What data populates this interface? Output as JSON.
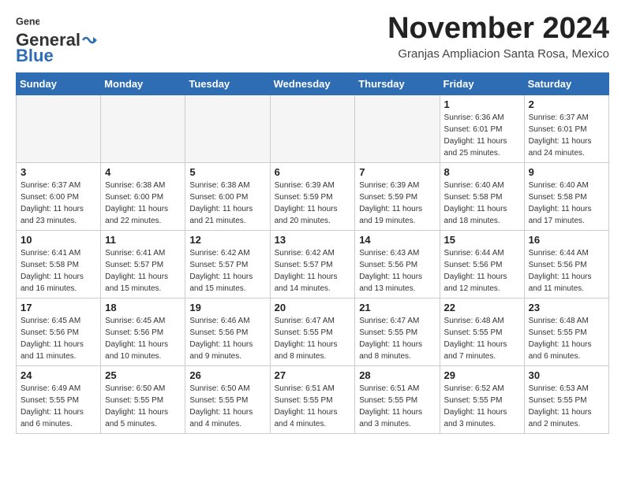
{
  "header": {
    "logo_general": "General",
    "logo_blue": "Blue",
    "month_title": "November 2024",
    "location": "Granjas Ampliacion Santa Rosa, Mexico"
  },
  "days_of_week": [
    "Sunday",
    "Monday",
    "Tuesday",
    "Wednesday",
    "Thursday",
    "Friday",
    "Saturday"
  ],
  "weeks": [
    [
      {
        "day": "",
        "info": ""
      },
      {
        "day": "",
        "info": ""
      },
      {
        "day": "",
        "info": ""
      },
      {
        "day": "",
        "info": ""
      },
      {
        "day": "",
        "info": ""
      },
      {
        "day": "1",
        "info": "Sunrise: 6:36 AM\nSunset: 6:01 PM\nDaylight: 11 hours and 25 minutes."
      },
      {
        "day": "2",
        "info": "Sunrise: 6:37 AM\nSunset: 6:01 PM\nDaylight: 11 hours and 24 minutes."
      }
    ],
    [
      {
        "day": "3",
        "info": "Sunrise: 6:37 AM\nSunset: 6:00 PM\nDaylight: 11 hours and 23 minutes."
      },
      {
        "day": "4",
        "info": "Sunrise: 6:38 AM\nSunset: 6:00 PM\nDaylight: 11 hours and 22 minutes."
      },
      {
        "day": "5",
        "info": "Sunrise: 6:38 AM\nSunset: 6:00 PM\nDaylight: 11 hours and 21 minutes."
      },
      {
        "day": "6",
        "info": "Sunrise: 6:39 AM\nSunset: 5:59 PM\nDaylight: 11 hours and 20 minutes."
      },
      {
        "day": "7",
        "info": "Sunrise: 6:39 AM\nSunset: 5:59 PM\nDaylight: 11 hours and 19 minutes."
      },
      {
        "day": "8",
        "info": "Sunrise: 6:40 AM\nSunset: 5:58 PM\nDaylight: 11 hours and 18 minutes."
      },
      {
        "day": "9",
        "info": "Sunrise: 6:40 AM\nSunset: 5:58 PM\nDaylight: 11 hours and 17 minutes."
      }
    ],
    [
      {
        "day": "10",
        "info": "Sunrise: 6:41 AM\nSunset: 5:58 PM\nDaylight: 11 hours and 16 minutes."
      },
      {
        "day": "11",
        "info": "Sunrise: 6:41 AM\nSunset: 5:57 PM\nDaylight: 11 hours and 15 minutes."
      },
      {
        "day": "12",
        "info": "Sunrise: 6:42 AM\nSunset: 5:57 PM\nDaylight: 11 hours and 15 minutes."
      },
      {
        "day": "13",
        "info": "Sunrise: 6:42 AM\nSunset: 5:57 PM\nDaylight: 11 hours and 14 minutes."
      },
      {
        "day": "14",
        "info": "Sunrise: 6:43 AM\nSunset: 5:56 PM\nDaylight: 11 hours and 13 minutes."
      },
      {
        "day": "15",
        "info": "Sunrise: 6:44 AM\nSunset: 5:56 PM\nDaylight: 11 hours and 12 minutes."
      },
      {
        "day": "16",
        "info": "Sunrise: 6:44 AM\nSunset: 5:56 PM\nDaylight: 11 hours and 11 minutes."
      }
    ],
    [
      {
        "day": "17",
        "info": "Sunrise: 6:45 AM\nSunset: 5:56 PM\nDaylight: 11 hours and 11 minutes."
      },
      {
        "day": "18",
        "info": "Sunrise: 6:45 AM\nSunset: 5:56 PM\nDaylight: 11 hours and 10 minutes."
      },
      {
        "day": "19",
        "info": "Sunrise: 6:46 AM\nSunset: 5:56 PM\nDaylight: 11 hours and 9 minutes."
      },
      {
        "day": "20",
        "info": "Sunrise: 6:47 AM\nSunset: 5:55 PM\nDaylight: 11 hours and 8 minutes."
      },
      {
        "day": "21",
        "info": "Sunrise: 6:47 AM\nSunset: 5:55 PM\nDaylight: 11 hours and 8 minutes."
      },
      {
        "day": "22",
        "info": "Sunrise: 6:48 AM\nSunset: 5:55 PM\nDaylight: 11 hours and 7 minutes."
      },
      {
        "day": "23",
        "info": "Sunrise: 6:48 AM\nSunset: 5:55 PM\nDaylight: 11 hours and 6 minutes."
      }
    ],
    [
      {
        "day": "24",
        "info": "Sunrise: 6:49 AM\nSunset: 5:55 PM\nDaylight: 11 hours and 6 minutes."
      },
      {
        "day": "25",
        "info": "Sunrise: 6:50 AM\nSunset: 5:55 PM\nDaylight: 11 hours and 5 minutes."
      },
      {
        "day": "26",
        "info": "Sunrise: 6:50 AM\nSunset: 5:55 PM\nDaylight: 11 hours and 4 minutes."
      },
      {
        "day": "27",
        "info": "Sunrise: 6:51 AM\nSunset: 5:55 PM\nDaylight: 11 hours and 4 minutes."
      },
      {
        "day": "28",
        "info": "Sunrise: 6:51 AM\nSunset: 5:55 PM\nDaylight: 11 hours and 3 minutes."
      },
      {
        "day": "29",
        "info": "Sunrise: 6:52 AM\nSunset: 5:55 PM\nDaylight: 11 hours and 3 minutes."
      },
      {
        "day": "30",
        "info": "Sunrise: 6:53 AM\nSunset: 5:55 PM\nDaylight: 11 hours and 2 minutes."
      }
    ]
  ]
}
